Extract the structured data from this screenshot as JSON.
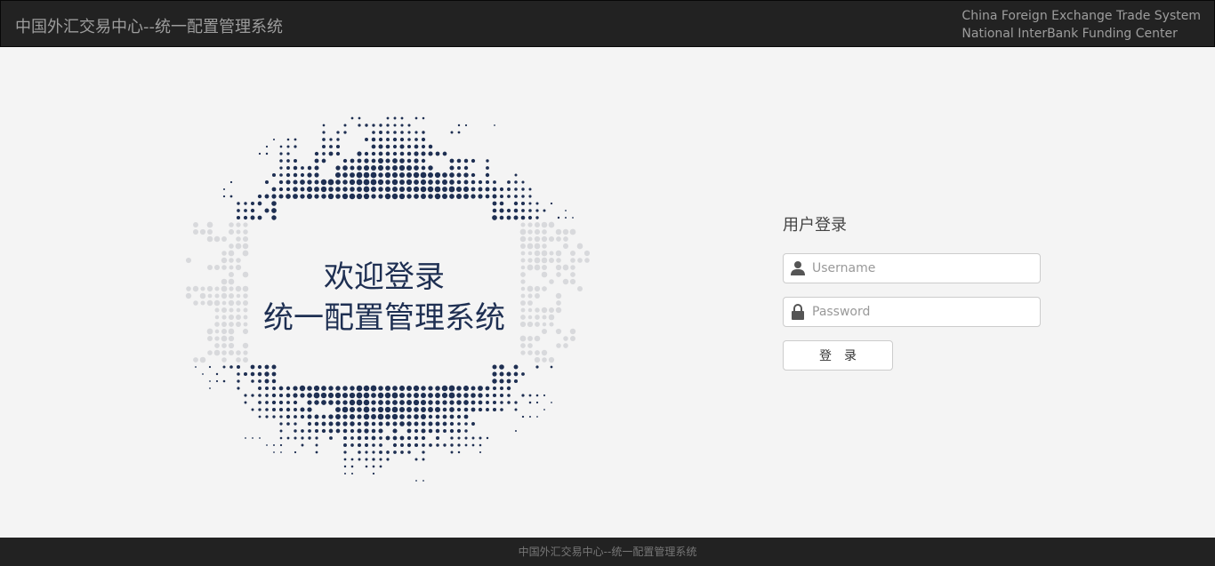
{
  "header": {
    "brand": "中国外汇交易中心--统一配置管理系统",
    "en_line1": "China Foreign Exchange Trade System",
    "en_line2": "National InterBank Funding Center"
  },
  "hero": {
    "line1": "欢迎登录",
    "line2": "统一配置管理系统",
    "dot_color": "#1e2f52",
    "fade_color": "#d8d9dc"
  },
  "login": {
    "title": "用户登录",
    "username_placeholder": "Username",
    "password_placeholder": "Password",
    "submit_label": "登录",
    "user_icon": "user-icon",
    "lock_icon": "lock-icon"
  },
  "footer": {
    "text": "中国外汇交易中心--统一配置管理系统"
  }
}
